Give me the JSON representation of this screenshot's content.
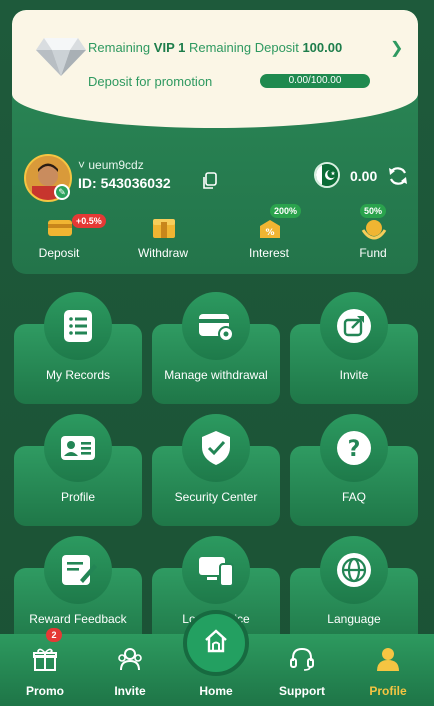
{
  "vip": {
    "remaining_prefix": "Remaining",
    "vip_level": "VIP 1",
    "remaining_deposit_label": "Remaining Deposit",
    "remaining_deposit_value": "100.00",
    "promo_label": "Deposit for promotion",
    "progress_text": "0.00/100.00",
    "progress_fraction": 0
  },
  "user": {
    "username": "ueum9cdz",
    "id_label": "ID:",
    "id_value": "543036032",
    "balance": "0.00"
  },
  "quick_actions": [
    {
      "label": "Deposit",
      "badge": "+0.5%",
      "badge_color": "#e53935",
      "icon": "deposit-icon"
    },
    {
      "label": "Withdraw",
      "badge": "",
      "badge_color": "",
      "icon": "withdraw-icon"
    },
    {
      "label": "Interest",
      "badge": "200%",
      "badge_color": "#2aa34d",
      "icon": "interest-icon"
    },
    {
      "label": "Fund",
      "badge": "50%",
      "badge_color": "#2aa34d",
      "icon": "fund-icon"
    }
  ],
  "menu": [
    {
      "label": "My Records",
      "icon": "records-icon"
    },
    {
      "label": "Manage withdrawal",
      "icon": "card-settings-icon"
    },
    {
      "label": "Invite",
      "icon": "share-icon"
    },
    {
      "label": "Profile",
      "icon": "profile-card-icon"
    },
    {
      "label": "Security Center",
      "icon": "shield-check-icon"
    },
    {
      "label": "FAQ",
      "icon": "question-icon"
    },
    {
      "label": "Reward Feedback",
      "icon": "feedback-icon"
    },
    {
      "label": "Login device",
      "icon": "devices-icon"
    },
    {
      "label": "Language",
      "icon": "globe-icon"
    }
  ],
  "nav": {
    "promo": "Promo",
    "promo_badge": "2",
    "invite": "Invite",
    "home": "Home",
    "support": "Support",
    "profile": "Profile"
  },
  "colors": {
    "accent": "#2e9960",
    "active_nav": "#f5c542",
    "background": "#1e5a3b"
  }
}
